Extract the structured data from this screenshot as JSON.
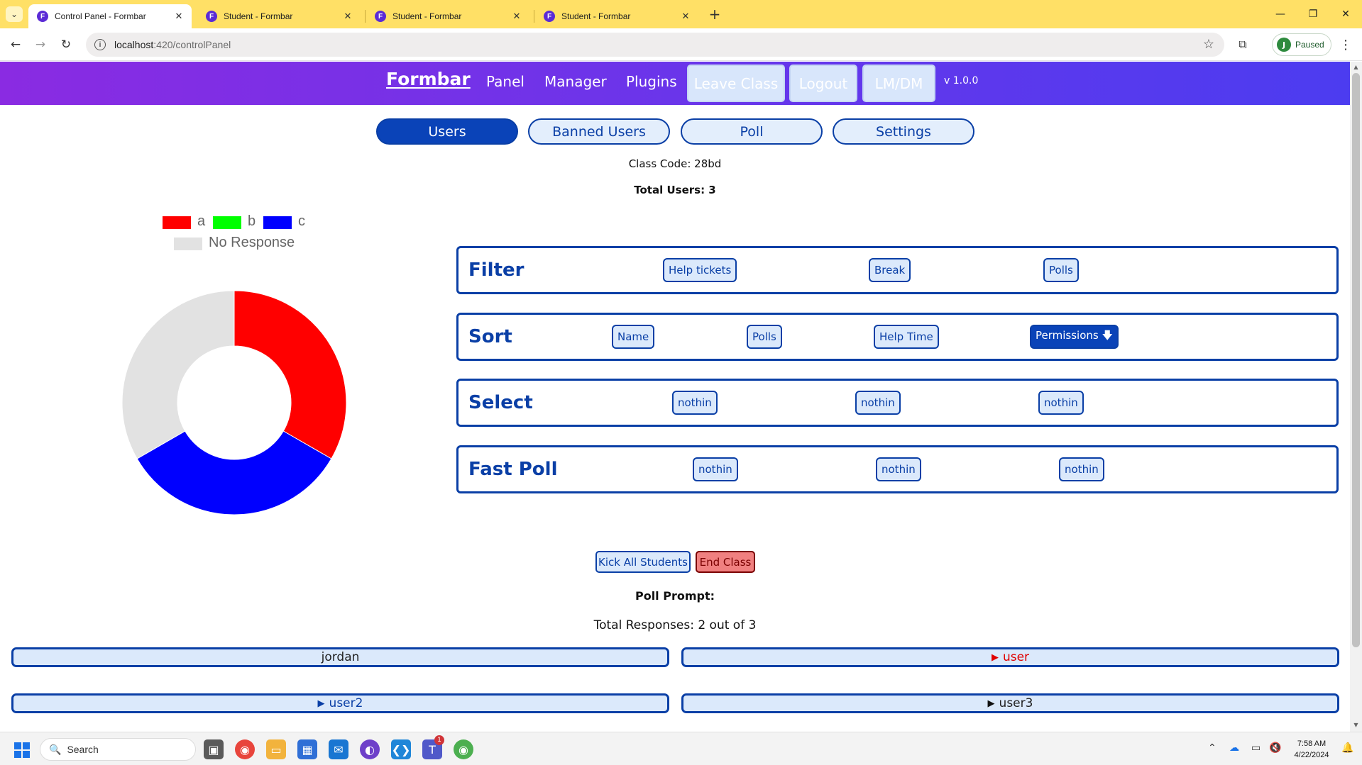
{
  "browser": {
    "tabs": [
      {
        "title": "Control Panel - Formbar",
        "active": true
      },
      {
        "title": "Student - Formbar",
        "active": false
      },
      {
        "title": "Student - Formbar",
        "active": false
      },
      {
        "title": "Student - Formbar",
        "active": false
      }
    ],
    "favicon_letter": "F",
    "url_host": "localhost",
    "url_path": ":420/controlPanel",
    "profile_initial": "J",
    "profile_status": "Paused"
  },
  "header": {
    "brand": "Formbar",
    "links": [
      "Panel",
      "Manager",
      "Plugins"
    ],
    "buttons": [
      "Leave Class",
      "Logout",
      "LM/DM"
    ],
    "version": "v 1.0.0"
  },
  "main_tabs": [
    "Users",
    "Banned Users",
    "Poll",
    "Settings"
  ],
  "class_code": "Class Code: 28bd",
  "total_users": "Total Users: 3",
  "chart_data": {
    "type": "pie",
    "donut": true,
    "categories": [
      "a",
      "b",
      "c",
      "No Response"
    ],
    "values": [
      1,
      0,
      1,
      1
    ],
    "colors": [
      "#ff0000",
      "#00ff00",
      "#0000ff",
      "#e2e2e2"
    ]
  },
  "controls": {
    "filter": {
      "title": "Filter",
      "buttons": [
        "Help tickets",
        "Break",
        "Polls"
      ]
    },
    "sort": {
      "title": "Sort",
      "buttons": [
        "Name",
        "Polls",
        "Help Time",
        "Permissions 🡇"
      ]
    },
    "select": {
      "title": "Select",
      "buttons": [
        "nothin",
        "nothin",
        "nothin"
      ]
    },
    "fast_poll": {
      "title": "Fast Poll",
      "buttons": [
        "nothin",
        "nothin",
        "nothin"
      ]
    }
  },
  "actions": {
    "kick": "Kick All Students",
    "end": "End Class"
  },
  "poll_prompt": "Poll Prompt:",
  "total_responses": "Total Responses: 2 out of 3",
  "users": [
    {
      "name": "jordan",
      "arrow": "",
      "color": "black"
    },
    {
      "name": "user",
      "arrow": "▶",
      "color": "red"
    },
    {
      "name": "user2",
      "arrow": "▶",
      "color": "blue"
    },
    {
      "name": "user3",
      "arrow": "▶",
      "color": "black"
    }
  ],
  "taskbar": {
    "search_placeholder": "Search",
    "time": "7:58 AM",
    "date": "4/22/2024",
    "teams_badge": "1"
  },
  "colors": {
    "primary": "#0a3fa6",
    "header_gradient_start": "#8a2be2",
    "header_gradient_end": "#4c3cf0",
    "tabstrip": "#ffe066"
  }
}
